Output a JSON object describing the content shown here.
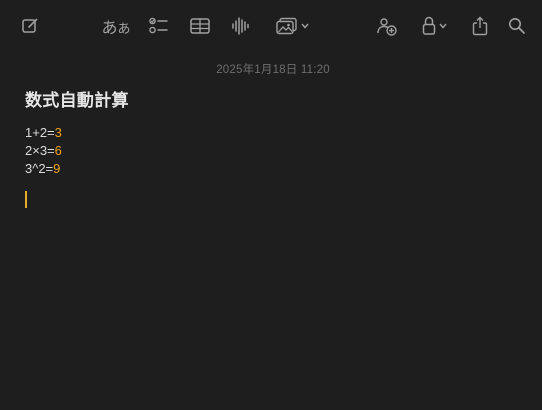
{
  "toolbar": {
    "buttons": [
      {
        "name": "compose-button",
        "icon": "compose-icon"
      },
      {
        "name": "format-button",
        "icon": "aa-format-icon",
        "label_big": "あ",
        "label_small": "あ"
      },
      {
        "name": "checklist-button",
        "icon": "checklist-icon"
      },
      {
        "name": "table-button",
        "icon": "table-icon"
      },
      {
        "name": "audio-button",
        "icon": "waveform-icon"
      },
      {
        "name": "media-button",
        "icon": "photo-icon"
      },
      {
        "name": "collaborate-button",
        "icon": "share-people-icon"
      },
      {
        "name": "lock-button",
        "icon": "lock-icon"
      },
      {
        "name": "share-button",
        "icon": "share-icon"
      },
      {
        "name": "search-button",
        "icon": "search-icon"
      }
    ]
  },
  "note": {
    "timestamp": "2025年1月18日 11:20",
    "title": "数式自動計算",
    "lines": [
      {
        "expr": "1+2=",
        "result": "3"
      },
      {
        "expr": "2×3=",
        "result": "6"
      },
      {
        "expr": "3^2=",
        "result": "9"
      }
    ]
  },
  "colors": {
    "background": "#1e1e1e",
    "accent": "#f0a21c",
    "text": "#dcdcdc",
    "icon": "#9d9d9d"
  }
}
